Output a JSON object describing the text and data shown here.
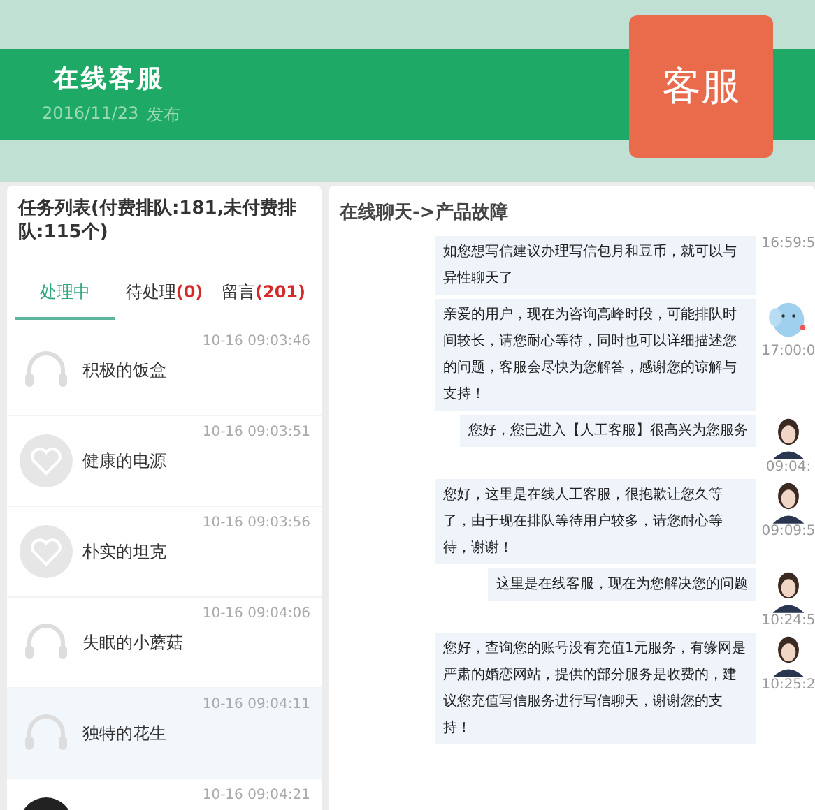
{
  "header": {
    "title": "在线客服",
    "date": "2016/11/23",
    "published": "发布",
    "badge": "客服"
  },
  "task_list": {
    "title": "任务列表(**付费排队:181,未付费排队:115**个)",
    "tabs": [
      {
        "label": "处理中",
        "selected": true
      },
      {
        "label": "待处理",
        "count": "(0)",
        "selected": false
      },
      {
        "label": "留言",
        "count": "(201)",
        "selected": false
      }
    ],
    "items": [
      {
        "kind": "headset",
        "name": "积极的饭盒",
        "time": "10-16 09:03:46",
        "selected": false
      },
      {
        "kind": "heart",
        "name": "健康的电源",
        "time": "10-16 09:03:51",
        "selected": false
      },
      {
        "kind": "heart",
        "name": "朴实的坦克",
        "time": "10-16 09:03:56",
        "selected": false
      },
      {
        "kind": "headset",
        "name": "失眠的小蘑菇",
        "time": "10-16 09:04:06",
        "selected": false
      },
      {
        "kind": "headset",
        "name": "独特的花生",
        "time": "10-16 09:04:11",
        "selected": true
      },
      {
        "kind": "dark",
        "time": "10-16 09:04:21",
        "selected": false
      }
    ]
  },
  "chat": {
    "title": "在线聊天->产品故障",
    "messages": [
      {
        "text": "如您想写信建议办理写信包月和豆币，就可以与异性聊天了",
        "time": "16:59:5"
      },
      {
        "text": "亲爱的用户，现在为咨询高峰时段，可能排队时间较长，请您耐心等待，同时也可以详细描述您的问题，客服会尽快为您解答，感谢您的谅解与支持！",
        "kind": "elephant",
        "time": "17:00:0"
      },
      {
        "text": "您好，您已进入【人工客服】很高兴为您服务",
        "kind": "person",
        "time": "09:04:"
      },
      {
        "text": "您好，这里是在线人工客服，很抱歉让您久等了，由于现在排队等待用户较多，请您耐心等待，谢谢！",
        "kind": "person",
        "time": "09:09:5"
      },
      {
        "text": "这里是在线客服，现在为您解决您的问题",
        "kind": "person",
        "time": "10:24:5"
      },
      {
        "text": "您好，查询您的账号没有充值1元服务，有缘网是严肃的婚恋网站，提供的部分服务是收费的，建议您充值写信服务进行写信聊天，谢谢您的支持！",
        "kind": "person",
        "time": "10:25:2"
      }
    ]
  }
}
